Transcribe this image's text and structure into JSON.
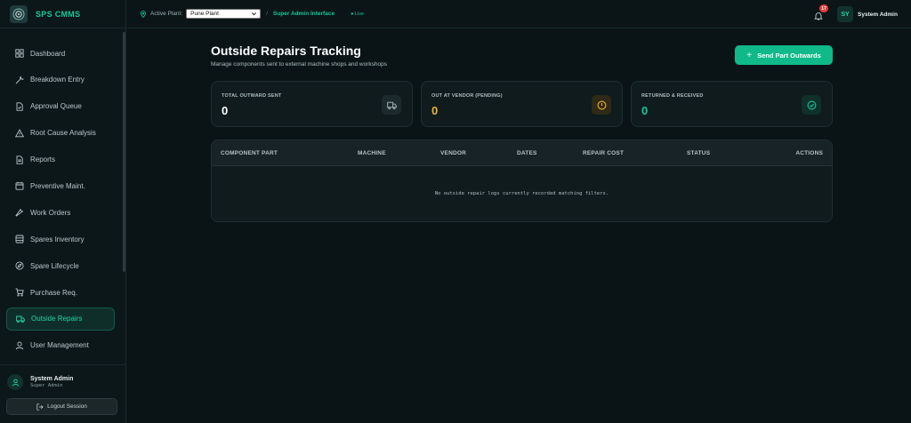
{
  "app": {
    "name": "SPS CMMS"
  },
  "sidebar": {
    "items": [
      {
        "label": "Dashboard",
        "icon": "grid-icon",
        "active": false
      },
      {
        "label": "Breakdown Entry",
        "icon": "wrench-icon",
        "active": false
      },
      {
        "label": "Approval Queue",
        "icon": "file-check-icon",
        "active": false
      },
      {
        "label": "Root Cause Analysis",
        "icon": "alert-triangle-icon",
        "active": false
      },
      {
        "label": "Reports",
        "icon": "file-text-icon",
        "active": false
      },
      {
        "label": "Preventive Maint.",
        "icon": "calendar-icon",
        "active": false
      },
      {
        "label": "Work Orders",
        "icon": "tool-icon",
        "active": false
      },
      {
        "label": "Spares Inventory",
        "icon": "database-icon",
        "active": false
      },
      {
        "label": "Spare Lifecycle",
        "icon": "compass-icon",
        "active": false
      },
      {
        "label": "Purchase Req.",
        "icon": "cart-icon",
        "active": false
      },
      {
        "label": "Outside Repairs",
        "icon": "truck-icon",
        "active": true
      },
      {
        "label": "User Management",
        "icon": "user-icon",
        "active": false
      }
    ],
    "user": {
      "name": "System Admin",
      "role": "Super Admin"
    },
    "logout_label": "Logout Session"
  },
  "topbar": {
    "plant_label": "Active Plant:",
    "plant_value": "Pune Plant",
    "separator": "/",
    "interface_label": "Super Admin Interface",
    "live_label": "● Live",
    "notification_count": "17",
    "avatar_initials": "SY",
    "user_name": "System Admin"
  },
  "page": {
    "title": "Outside Repairs Tracking",
    "subtitle": "Manage components sent to external machine shops and workshops",
    "primary_action": "Send Part Outwards"
  },
  "stats": [
    {
      "label": "TOTAL OUTWARD SENT",
      "value": "0",
      "color": "#ffffff",
      "icon": "truck-icon",
      "icon_color": "#9fb0b3",
      "icon_bg": "#1c2a2d"
    },
    {
      "label": "OUT AT VENDOR (PENDING)",
      "value": "0",
      "color": "#f0b429",
      "icon": "alert-circle-icon",
      "icon_color": "#f0b429",
      "icon_bg": "#2e2a16"
    },
    {
      "label": "RETURNED & RECEIVED",
      "value": "0",
      "color": "#10c99a",
      "icon": "check-circle-icon",
      "icon_color": "#10c99a",
      "icon_bg": "#10302a"
    }
  ],
  "table": {
    "columns": [
      "COMPONENT PART",
      "MACHINE",
      "VENDOR",
      "DATES",
      "REPAIR COST",
      "STATUS",
      "ACTIONS"
    ],
    "empty_message": "No outside repair logs currently recorded matching filters."
  },
  "colors": {
    "accent": "#10c99a",
    "background": "#0a1416",
    "card": "#0f1b1d"
  }
}
